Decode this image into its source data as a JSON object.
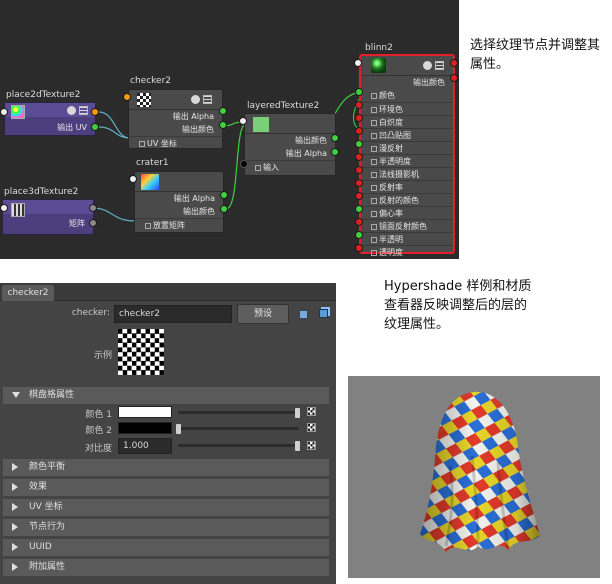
{
  "hypershade": {
    "nodes": {
      "place2d": {
        "title": "place2dTexture2",
        "out_uv": "输出 UV"
      },
      "checker": {
        "title": "checker2",
        "out_alpha": "输出 Alpha",
        "out_color": "输出颜色",
        "in_uv": "UV 坐标"
      },
      "crater": {
        "title": "crater1",
        "out_alpha": "输出 Alpha",
        "out_color": "输出颜色",
        "in_matrix": "放置矩阵"
      },
      "place3d": {
        "title": "place3dTexture2",
        "out_matrix": "矩阵"
      },
      "layered": {
        "title": "layeredTexture2",
        "out_color": "输出颜色",
        "out_alpha": "输出 Alpha",
        "in_input": "输入"
      },
      "blinn": {
        "title": "blinn2",
        "out_color": "输出颜色",
        "inputs": [
          "颜色",
          "环境色",
          "白炽度",
          "凹凸贴图",
          "漫反射",
          "半透明度",
          "法线摄影机",
          "反射率",
          "反射的颜色",
          "偏心率",
          "镜面反射颜色",
          "半透明",
          "透明度"
        ]
      }
    }
  },
  "caption_top": "选择纹理节点并调整其属性。",
  "caption_mid": "Hypershade 样例和材质查看器反映调整后的层的纹理属性。",
  "attribute_editor": {
    "tab": "checker2",
    "node_type_label": "checker:",
    "node_name": "checker2",
    "preset_button": "预设",
    "sample_label": "示例",
    "section_open": "棋盘格属性",
    "color1_label": "颜色 1",
    "color1": "#ffffff",
    "color2_label": "颜色 2",
    "color2": "#000000",
    "contrast_label": "对比度",
    "contrast_value": "1.000",
    "sections_closed": [
      "颜色平衡",
      "效果",
      "UV 坐标",
      "节点行为",
      "UUID",
      "附加属性"
    ]
  },
  "colors": {
    "editor_bg": "#2b2b2b",
    "blinn_selected": "#e0202a",
    "port_green": "#3fcf3f",
    "port_red": "#e02020"
  }
}
